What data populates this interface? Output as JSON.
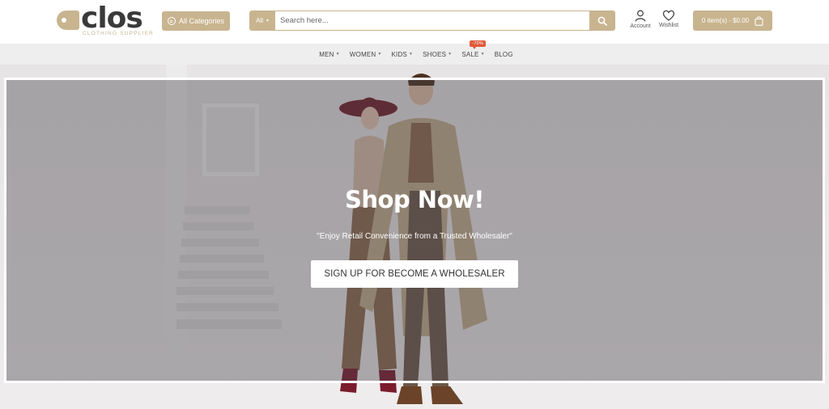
{
  "header": {
    "logo": {
      "word": "clos",
      "tagline": "CLOTHING SUPPLIER"
    },
    "categories_label": "All Categories",
    "search": {
      "scope_label": "All",
      "placeholder": "Search here..."
    },
    "account_label": "Account",
    "wishlist_label": "Wishlist",
    "cart_label": "0 item(s) - $0.00"
  },
  "nav": {
    "items": [
      {
        "label": "MEN",
        "dropdown": true
      },
      {
        "label": "WOMEN",
        "dropdown": true
      },
      {
        "label": "KIDS",
        "dropdown": true
      },
      {
        "label": "SHOES",
        "dropdown": true
      },
      {
        "label": "SALE",
        "dropdown": true,
        "badge": "-70%"
      },
      {
        "label": "BLOG",
        "dropdown": false
      }
    ]
  },
  "hero": {
    "title": "Shop Now!",
    "subtitle": "\"Enjoy Retail Convenience from a Trusted Wholesaler\"",
    "cta_label": "SIGN UP FOR BECOME A WHOLESALER"
  },
  "icons": {
    "categories": "list-circle-icon",
    "search": "search-icon",
    "account": "user-icon",
    "wishlist": "heart-icon",
    "cart": "shopping-bag-icon",
    "dropdown": "chevron-down-icon"
  },
  "colors": {
    "accent": "#c8b48f",
    "logo_text": "#3a3a3a",
    "sale_badge": "#e05a3a",
    "nav_background": "#eeeeee"
  }
}
